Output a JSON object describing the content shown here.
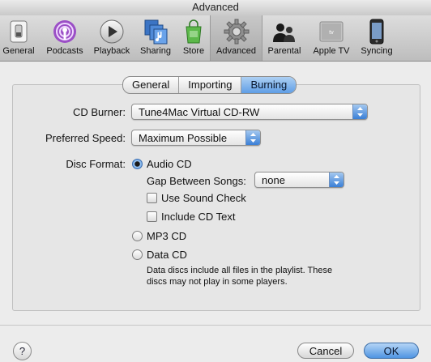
{
  "window": {
    "title": "Advanced"
  },
  "toolbar": {
    "items": [
      {
        "label": "General",
        "icon": "general-switch-icon",
        "selected": false
      },
      {
        "label": "Podcasts",
        "icon": "podcast-icon",
        "selected": false
      },
      {
        "label": "Playback",
        "icon": "playback-icon",
        "selected": false
      },
      {
        "label": "Sharing",
        "icon": "sharing-icon",
        "selected": false
      },
      {
        "label": "Store",
        "icon": "store-bag-icon",
        "selected": false
      },
      {
        "label": "Advanced",
        "icon": "gear-icon",
        "selected": true
      },
      {
        "label": "Parental",
        "icon": "parental-icon",
        "selected": false
      },
      {
        "label": "Apple TV",
        "icon": "apple-tv-icon",
        "selected": false
      },
      {
        "label": "Syncing",
        "icon": "iphone-icon",
        "selected": false
      }
    ]
  },
  "tabs": [
    {
      "label": "General",
      "active": false
    },
    {
      "label": "Importing",
      "active": false
    },
    {
      "label": "Burning",
      "active": true
    }
  ],
  "burning": {
    "cd_burner_label": "CD Burner:",
    "cd_burner_value": "Tune4Mac Virtual CD-RW",
    "preferred_speed_label": "Preferred Speed:",
    "preferred_speed_value": "Maximum Possible",
    "disc_format_label": "Disc Format:",
    "audio_cd_label": "Audio CD",
    "audio_cd_selected": true,
    "gap_label": "Gap Between Songs:",
    "gap_value": "none",
    "sound_check_label": "Use Sound Check",
    "sound_check_checked": false,
    "cd_text_label": "Include CD Text",
    "cd_text_checked": false,
    "mp3_cd_label": "MP3 CD",
    "data_cd_label": "Data CD",
    "data_cd_note_1": "Data discs include all files in the playlist. These",
    "data_cd_note_2": "discs may not play in some players."
  },
  "footer": {
    "help_label": "?",
    "cancel_label": "Cancel",
    "ok_label": "OK"
  },
  "colors": {
    "accent": "#5f9ee6",
    "window_bg": "#ececec"
  }
}
